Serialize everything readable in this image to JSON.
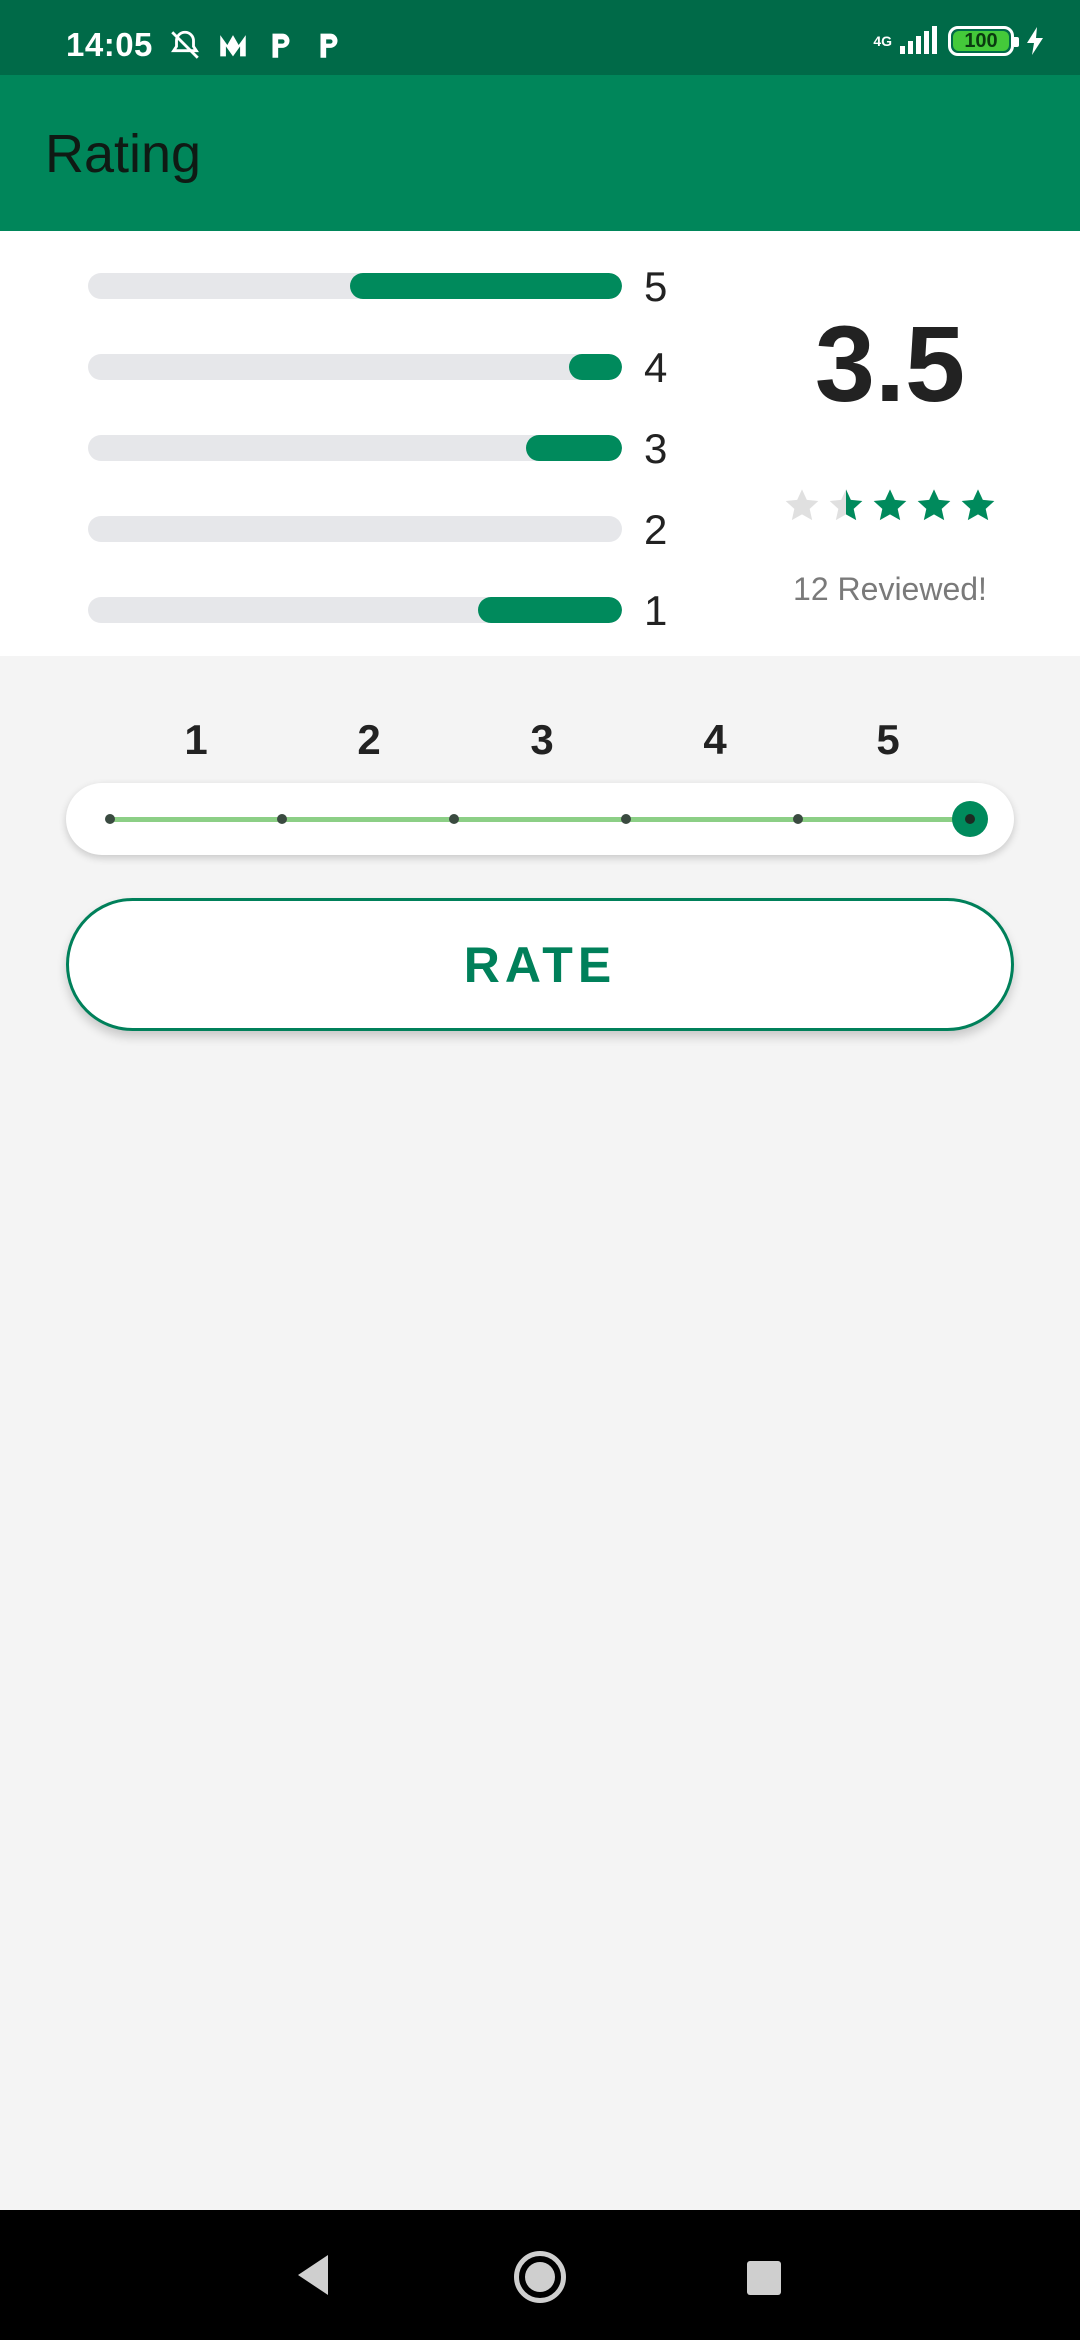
{
  "status_bar": {
    "time": "14:05",
    "network": "4G",
    "battery": "100",
    "icons": [
      "mute-alarm-icon",
      "m-app-icon",
      "p-app-icon",
      "p-app-icon",
      "signal-icon",
      "battery-icon",
      "charging-icon"
    ]
  },
  "app_bar": {
    "title": "Rating"
  },
  "summary": {
    "average": "3.5",
    "reviewed": "12 Reviewed!",
    "star_rating": 3.5,
    "distribution": [
      {
        "label": "5",
        "fraction": 0.51
      },
      {
        "label": "4",
        "fraction": 0.1
      },
      {
        "label": "3",
        "fraction": 0.18
      },
      {
        "label": "2",
        "fraction": 0.0
      },
      {
        "label": "1",
        "fraction": 0.27
      }
    ]
  },
  "rating_scale": {
    "labels": [
      "1",
      "2",
      "3",
      "4",
      "5"
    ],
    "selected": "5"
  },
  "rate_button": {
    "label": "RATE"
  },
  "colors": {
    "accent": "#008a5c",
    "status_bar": "#006a48",
    "app_bar": "#00865a",
    "track": "#e6e7ea",
    "star_empty": "#e0e0e0",
    "slider_line": "#8ccf86"
  }
}
